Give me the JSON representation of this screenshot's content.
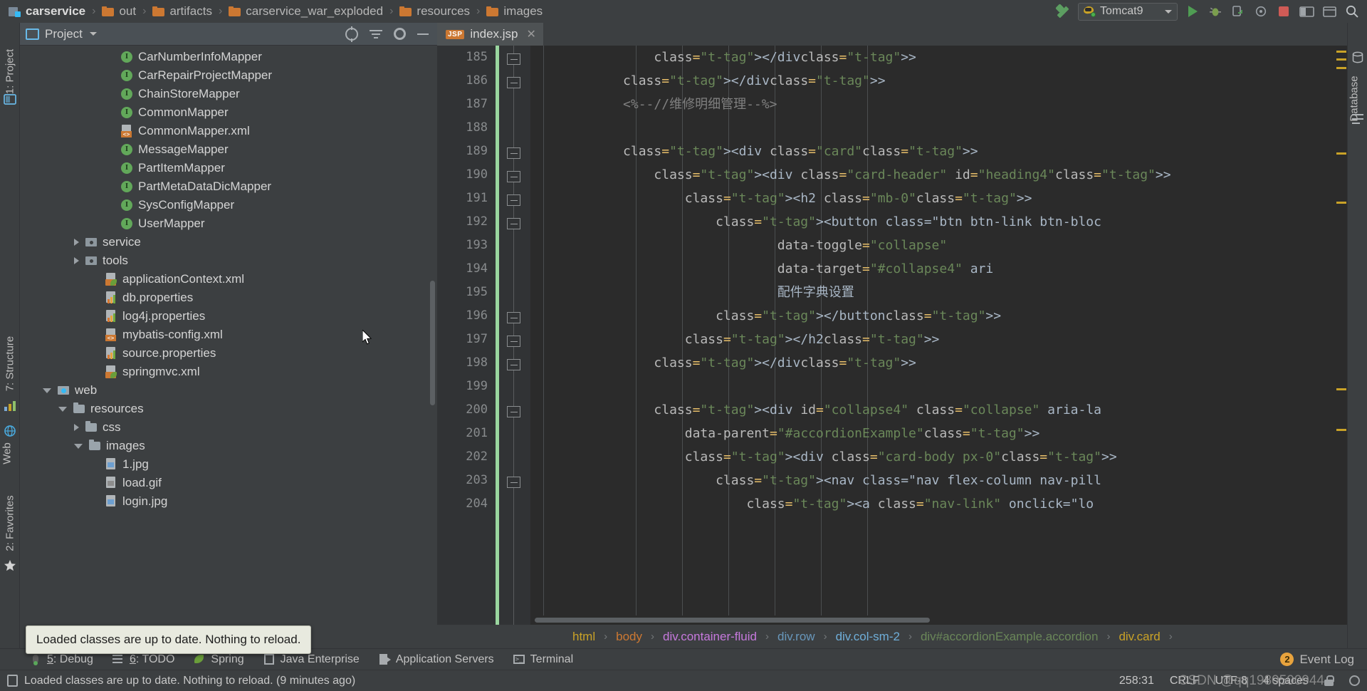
{
  "topbar": {
    "breadcrumbs": [
      {
        "label": "carservice",
        "icon": "module-icon"
      },
      {
        "label": "out",
        "icon": "folder-icon"
      },
      {
        "label": "artifacts",
        "icon": "folder-icon"
      },
      {
        "label": "carservice_war_exploded",
        "icon": "folder-icon"
      },
      {
        "label": "resources",
        "icon": "folder-icon"
      },
      {
        "label": "images",
        "icon": "folder-icon"
      }
    ],
    "separator": "›",
    "build_icon": "hammer-build-icon",
    "run_config": {
      "label": "Tomcat9",
      "icon": "tomcat-icon",
      "chevron": "chevron-down-icon"
    },
    "actions": [
      {
        "name": "run-button",
        "icon": "run-triangle-icon"
      },
      {
        "name": "debug-button",
        "icon": "bug-icon"
      },
      {
        "name": "run-with-coverage-button",
        "icon": "coverage-icon"
      },
      {
        "name": "profile-button",
        "icon": "profiler-icon"
      },
      {
        "name": "stop-button",
        "icon": "stop-square-icon"
      },
      {
        "name": "update-application-button",
        "icon": "update-icon"
      },
      {
        "name": "layout-button",
        "icon": "layout-icon"
      },
      {
        "name": "search-everywhere-button",
        "icon": "search-icon"
      }
    ]
  },
  "left_rail": {
    "items": [
      {
        "label": "1: Project",
        "icon": "project-icon"
      },
      {
        "label": "7: Structure",
        "icon": "structure-icon"
      },
      {
        "label": "Web",
        "icon": "web-icon"
      },
      {
        "label": "2: Favorites",
        "icon": "favorites-star-icon"
      }
    ]
  },
  "right_rail": {
    "items": [
      {
        "label": "Database",
        "icon": "database-icon"
      }
    ]
  },
  "project_panel": {
    "title": "Project",
    "title_chevron": "chevron-down-icon",
    "header_actions": [
      {
        "name": "select-opened-file-button",
        "icon": "target-icon"
      },
      {
        "name": "collapse-all-button",
        "icon": "collapse-all-icon"
      },
      {
        "name": "settings-button",
        "icon": "gear-icon"
      },
      {
        "name": "hide-button",
        "icon": "minimize-icon"
      }
    ],
    "tree": [
      {
        "label": "CarNumberInfoMapper",
        "icon": "interface-icon",
        "indent": 5,
        "arrow": "none"
      },
      {
        "label": "CarRepairProjectMapper",
        "icon": "interface-icon",
        "indent": 5,
        "arrow": "none"
      },
      {
        "label": "ChainStoreMapper",
        "icon": "interface-icon",
        "indent": 5,
        "arrow": "none"
      },
      {
        "label": "CommonMapper",
        "icon": "interface-icon",
        "indent": 5,
        "arrow": "none"
      },
      {
        "label": "CommonMapper.xml",
        "icon": "xml-file-icon",
        "indent": 5,
        "arrow": "none"
      },
      {
        "label": "MessageMapper",
        "icon": "interface-icon",
        "indent": 5,
        "arrow": "none"
      },
      {
        "label": "PartItemMapper",
        "icon": "interface-icon",
        "indent": 5,
        "arrow": "none"
      },
      {
        "label": "PartMetaDataDicMapper",
        "icon": "interface-icon",
        "indent": 5,
        "arrow": "none"
      },
      {
        "label": "SysConfigMapper",
        "icon": "interface-icon",
        "indent": 5,
        "arrow": "none"
      },
      {
        "label": "UserMapper",
        "icon": "interface-icon",
        "indent": 5,
        "arrow": "none"
      },
      {
        "label": "service",
        "icon": "source-folder-icon",
        "indent": 3,
        "arrow": "right"
      },
      {
        "label": "tools",
        "icon": "source-folder-icon",
        "indent": 3,
        "arrow": "right"
      },
      {
        "label": "applicationContext.xml",
        "icon": "spring-file-icon",
        "indent": 4,
        "arrow": "none"
      },
      {
        "label": "db.properties",
        "icon": "properties-icon",
        "indent": 4,
        "arrow": "none"
      },
      {
        "label": "log4j.properties",
        "icon": "properties-icon",
        "indent": 4,
        "arrow": "none"
      },
      {
        "label": "mybatis-config.xml",
        "icon": "xml-file-icon",
        "indent": 4,
        "arrow": "none"
      },
      {
        "label": "source.properties",
        "icon": "properties-icon",
        "indent": 4,
        "arrow": "none"
      },
      {
        "label": "springmvc.xml",
        "icon": "spring-file-icon",
        "indent": 4,
        "arrow": "none"
      },
      {
        "label": "web",
        "icon": "web-folder-icon",
        "indent": 1,
        "arrow": "down"
      },
      {
        "label": "resources",
        "icon": "folder-icon",
        "indent": 2,
        "arrow": "down"
      },
      {
        "label": "css",
        "icon": "folder-icon",
        "indent": 3,
        "arrow": "right"
      },
      {
        "label": "images",
        "icon": "folder-icon",
        "indent": 3,
        "arrow": "down"
      },
      {
        "label": "1.jpg",
        "icon": "image-file-icon",
        "indent": 4,
        "arrow": "none"
      },
      {
        "label": "load.gif",
        "icon": "gif-file-icon",
        "indent": 4,
        "arrow": "none"
      },
      {
        "label": "login.jpg",
        "icon": "image-file-icon",
        "indent": 4,
        "arrow": "none"
      }
    ]
  },
  "balloon": {
    "text": "Loaded classes are up to date. Nothing to reload."
  },
  "editor": {
    "tab": {
      "label": "index.jsp",
      "file_type": "JSP",
      "close_icon": "close-icon"
    },
    "first_line": 185,
    "line_numbers": [
      185,
      186,
      187,
      188,
      189,
      190,
      191,
      192,
      193,
      194,
      195,
      196,
      197,
      198,
      199,
      200,
      201,
      202,
      203,
      204
    ],
    "code_lines": [
      "                </div>",
      "            </div>",
      "            <%--//维修明细管理--%>",
      "",
      "            <div class=\"card\">",
      "                <div class=\"card-header\" id=\"heading4\">",
      "                    <h2 class=\"mb-0\">",
      "                        <button class=\"btn btn-link btn-bloc",
      "                                data-toggle=\"collapse\"",
      "                                data-target=\"#collapse4\" ari",
      "                                配件字典设置",
      "                        </button>",
      "                    </h2>",
      "                </div>",
      "",
      "                <div id=\"collapse4\" class=\"collapse\" aria-la",
      "                    data-parent=\"#accordionExample\">",
      "                    <div class=\"card-body px-0\">",
      "                        <nav class=\"nav flex-column nav-pill",
      "                            <a class=\"nav-link\" onclick=\"lo"
    ],
    "breadcrumbs": [
      {
        "label": "html",
        "color": "#c9a227"
      },
      {
        "label": "body",
        "color": "#cc7832"
      },
      {
        "label": "div.container-fluid",
        "color": "#c679dd"
      },
      {
        "label": "div.row",
        "color": "#6897bb"
      },
      {
        "label": "div.col-sm-2",
        "color": "#6faed9"
      },
      {
        "label": "div#accordionExample.accordion",
        "color": "#6a8759"
      },
      {
        "label": "div.card",
        "color": "#c9a227"
      }
    ],
    "breadcrumb_separator": "›"
  },
  "tool_window_bar": {
    "items": [
      {
        "num": "5",
        "label": "Debug",
        "icon": "bug-icon"
      },
      {
        "num": "6",
        "label": "TODO",
        "icon": "todo-list-icon"
      },
      {
        "num": "",
        "label": "Spring",
        "icon": "spring-leaf-icon"
      },
      {
        "num": "",
        "label": "Java Enterprise",
        "icon": "java-enterprise-icon"
      },
      {
        "num": "",
        "label": "Application Servers",
        "icon": "application-servers-icon"
      },
      {
        "num": "",
        "label": "Terminal",
        "icon": "terminal-icon"
      }
    ],
    "event_log": {
      "label": "Event Log",
      "count": "2"
    }
  },
  "status_bar": {
    "message": "Loaded classes are up to date. Nothing to reload. (9 minutes ago)",
    "message_icon": "notification-icon",
    "caret_position": "258:31",
    "line_separator": "CRLF",
    "encoding": "UTF-8",
    "indent": "4 spaces",
    "lock_icon": "lock-icon",
    "inspection_icon": "inspection-face-icon",
    "watermark": "CSDN @qq1980500944"
  }
}
